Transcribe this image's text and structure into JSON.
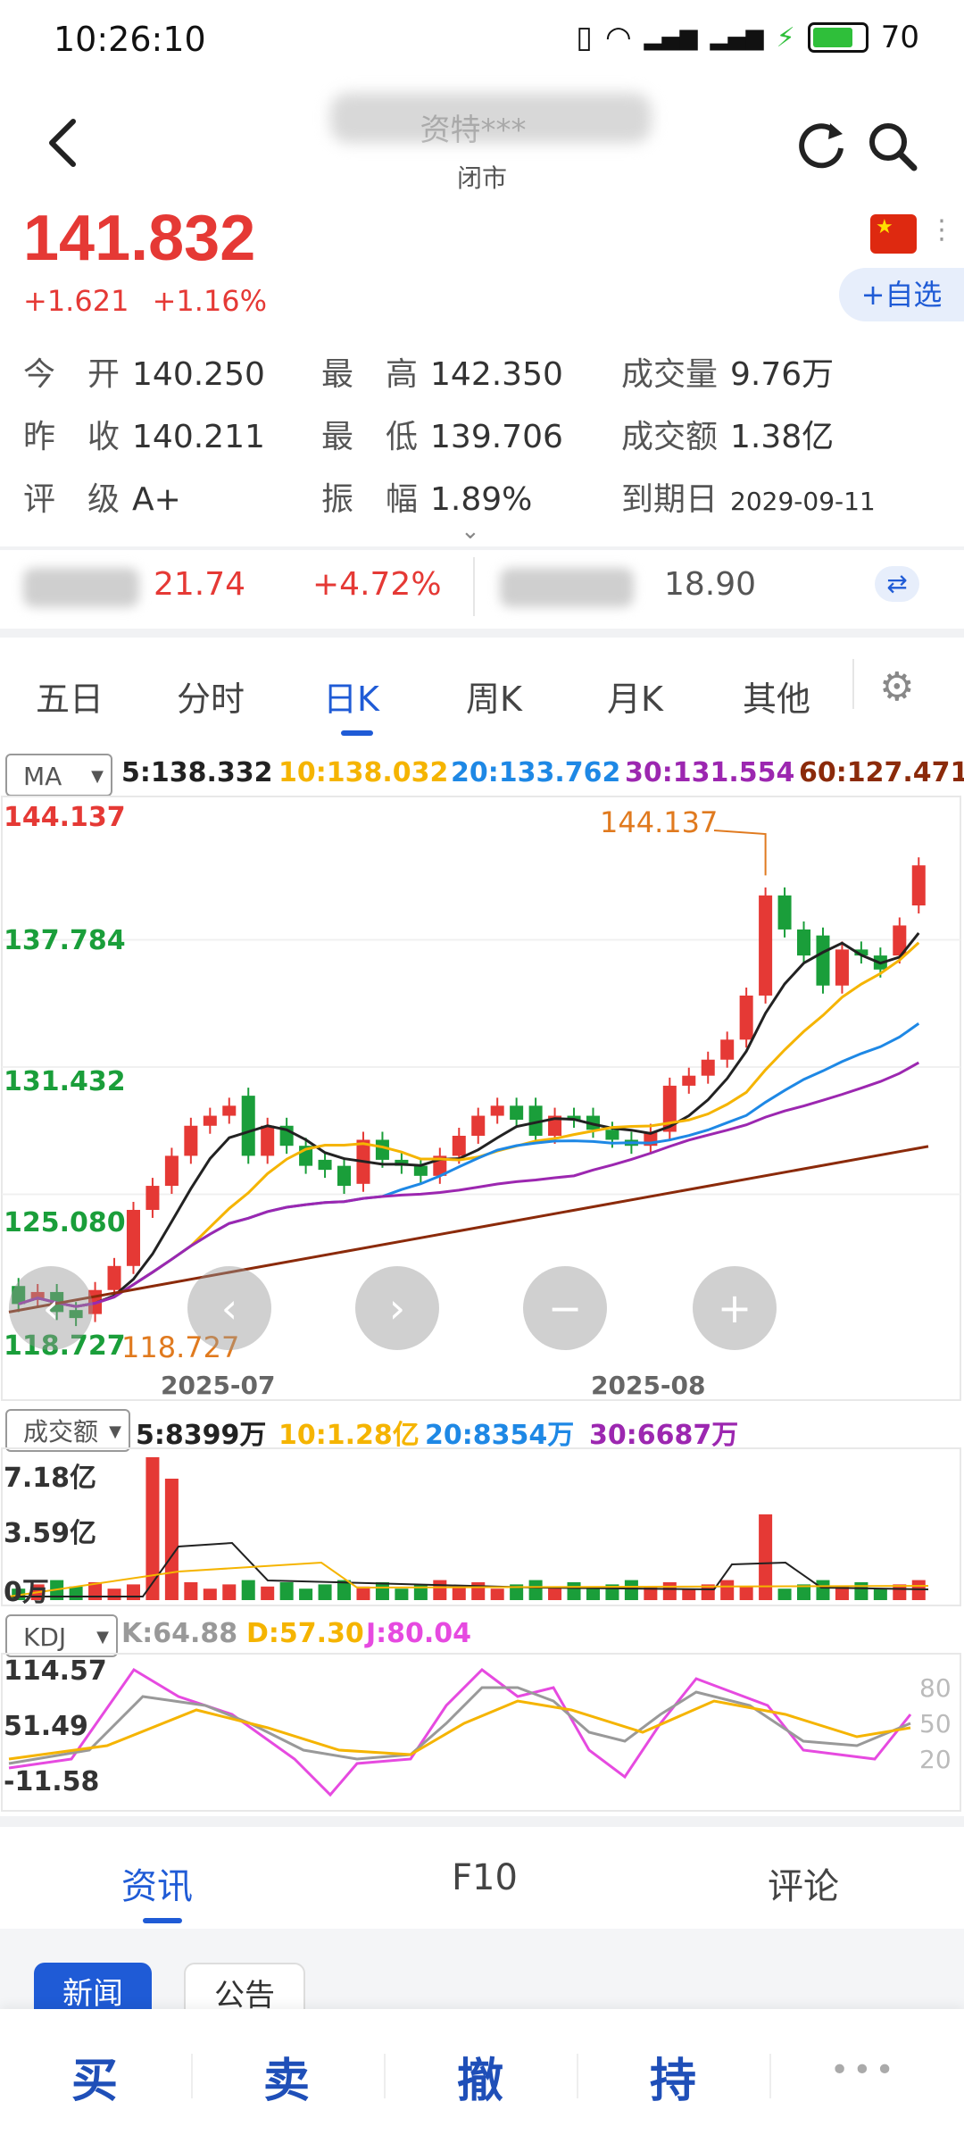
{
  "status": {
    "time": "10:26:10",
    "battery": "70"
  },
  "header": {
    "title": "资特***",
    "subtitle": "闭市"
  },
  "quote": {
    "price": "141.832",
    "change": "+1.621",
    "change_pct": "+1.16%",
    "watch_label": "+自选"
  },
  "stats": [
    {
      "label": "今　开",
      "value": "140.250"
    },
    {
      "label": "最　高",
      "value": "142.350"
    },
    {
      "label": "成交量",
      "value": "9.76万"
    },
    {
      "label": "昨　收",
      "value": "140.211"
    },
    {
      "label": "最　低",
      "value": "139.706"
    },
    {
      "label": "成交额",
      "value": "1.38亿"
    },
    {
      "label": "评　级",
      "value": "A+"
    },
    {
      "label": "振　幅",
      "value": "1.89%"
    },
    {
      "label": "到期日",
      "value": "2029-09-11"
    }
  ],
  "related": {
    "a_price": "21.74",
    "a_pct": "+4.72%",
    "b_price": "18.90"
  },
  "chart_tabs": [
    "五日",
    "分时",
    "日K",
    "周K",
    "月K",
    "其他"
  ],
  "main_chart": {
    "indicator": "MA",
    "legend": [
      {
        "text": "5:138.332",
        "color": "#222222"
      },
      {
        "text": "10:138.032",
        "color": "#f5b400"
      },
      {
        "text": "20:133.762",
        "color": "#1e88e5"
      },
      {
        "text": "30:131.554",
        "color": "#9c27b0"
      },
      {
        "text": "60:127.471",
        "color": "#8b2a0a"
      }
    ],
    "y_labels": [
      "144.137",
      "137.784",
      "131.432",
      "125.080",
      "118.727"
    ],
    "x_labels": [
      "2025-07",
      "2025-08"
    ],
    "high_marker": "144.137",
    "low_marker": "118.727"
  },
  "chart_data": {
    "type": "candlestick",
    "ylim": [
      118.727,
      144.137
    ],
    "candles": [
      {
        "o": 120.5,
        "c": 119.6
      },
      {
        "o": 119.8,
        "c": 120.2
      },
      {
        "o": 120.2,
        "c": 119.2
      },
      {
        "o": 119.3,
        "c": 118.9
      },
      {
        "o": 119.1,
        "c": 120.3
      },
      {
        "o": 120.3,
        "c": 121.5
      },
      {
        "o": 121.5,
        "c": 124.3
      },
      {
        "o": 124.3,
        "c": 125.5
      },
      {
        "o": 125.5,
        "c": 127.0
      },
      {
        "o": 127.0,
        "c": 128.5
      },
      {
        "o": 128.5,
        "c": 129.0
      },
      {
        "o": 129.0,
        "c": 129.5
      },
      {
        "o": 130.0,
        "c": 127.0
      },
      {
        "o": 127.0,
        "c": 128.5
      },
      {
        "o": 128.5,
        "c": 127.5
      },
      {
        "o": 127.5,
        "c": 126.5
      },
      {
        "o": 126.8,
        "c": 126.3
      },
      {
        "o": 126.5,
        "c": 125.5
      },
      {
        "o": 125.6,
        "c": 127.8
      },
      {
        "o": 127.8,
        "c": 126.8
      },
      {
        "o": 126.8,
        "c": 126.5
      },
      {
        "o": 126.5,
        "c": 126.0
      },
      {
        "o": 126.0,
        "c": 127.0
      },
      {
        "o": 127.0,
        "c": 128.0
      },
      {
        "o": 128.0,
        "c": 129.0
      },
      {
        "o": 129.0,
        "c": 129.5
      },
      {
        "o": 129.5,
        "c": 128.8
      },
      {
        "o": 129.5,
        "c": 128.0
      },
      {
        "o": 128.0,
        "c": 129.0
      },
      {
        "o": 129.0,
        "c": 128.8
      },
      {
        "o": 129.0,
        "c": 128.3
      },
      {
        "o": 128.3,
        "c": 127.8
      },
      {
        "o": 127.8,
        "c": 127.5
      },
      {
        "o": 127.5,
        "c": 128.2
      },
      {
        "o": 128.2,
        "c": 130.5
      },
      {
        "o": 130.5,
        "c": 131.0
      },
      {
        "o": 131.0,
        "c": 131.8
      },
      {
        "o": 131.8,
        "c": 132.8
      },
      {
        "o": 132.8,
        "c": 135.0
      },
      {
        "o": 135.0,
        "c": 140.0
      },
      {
        "o": 140.0,
        "c": 138.3
      },
      {
        "o": 138.3,
        "c": 137.0
      },
      {
        "o": 138.0,
        "c": 135.5
      },
      {
        "o": 135.5,
        "c": 137.3
      },
      {
        "o": 137.3,
        "c": 137.0
      },
      {
        "o": 137.0,
        "c": 136.3
      },
      {
        "o": 137.0,
        "c": 138.5
      },
      {
        "o": 139.5,
        "c": 141.5
      }
    ],
    "volume_legend": [
      "5:8399万",
      "10:1.28亿",
      "20:8354万",
      "30:6687万"
    ],
    "volume_axis": [
      "7.18亿",
      "3.59亿",
      "0万"
    ],
    "kdj_legend": [
      "K:64.88",
      "D:57.30",
      "J:80.04"
    ],
    "kdj_axis": [
      "114.57",
      "51.49",
      "-11.58"
    ],
    "kdj_right_axis": [
      "80",
      "50",
      "20"
    ]
  },
  "volume": {
    "indicator": "成交额"
  },
  "kdj": {
    "indicator": "KDJ"
  },
  "bottom_tabs": [
    "资讯",
    "F10",
    "评论"
  ],
  "news_pills": [
    "新闻",
    "公告"
  ],
  "actions": [
    "买",
    "卖",
    "撤",
    "持",
    "•••"
  ]
}
